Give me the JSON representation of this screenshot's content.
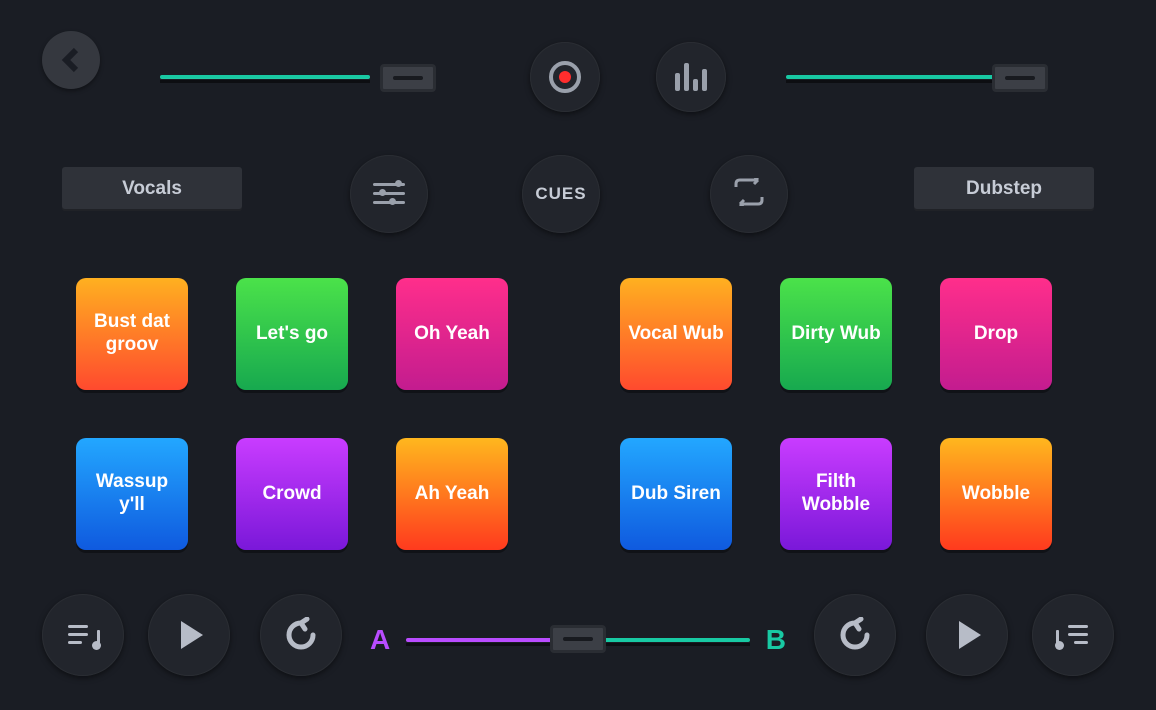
{
  "top": {
    "cues_label": "CUES"
  },
  "mid": {
    "left_bank_label": "Vocals",
    "right_bank_label": "Dubstep"
  },
  "banks": {
    "left": [
      {
        "label": "Bust dat groov",
        "color": "orange"
      },
      {
        "label": "Let's go",
        "color": "green"
      },
      {
        "label": "Oh Yeah",
        "color": "pink"
      },
      {
        "label": "Wassup y'll",
        "color": "blue"
      },
      {
        "label": "Crowd",
        "color": "purple"
      },
      {
        "label": "Ah Yeah",
        "color": "fire"
      }
    ],
    "right": [
      {
        "label": "Vocal Wub",
        "color": "orange"
      },
      {
        "label": "Dirty Wub",
        "color": "green"
      },
      {
        "label": "Drop",
        "color": "pink"
      },
      {
        "label": "Dub Siren",
        "color": "blue"
      },
      {
        "label": "Filth Wobble",
        "color": "purple"
      },
      {
        "label": "Wobble",
        "color": "fire"
      }
    ]
  },
  "crossfader": {
    "a_label": "A",
    "b_label": "B"
  },
  "colors": {
    "accent_a": "#b94cff",
    "accent_b": "#18c9a3",
    "record": "#ff2d2d"
  }
}
